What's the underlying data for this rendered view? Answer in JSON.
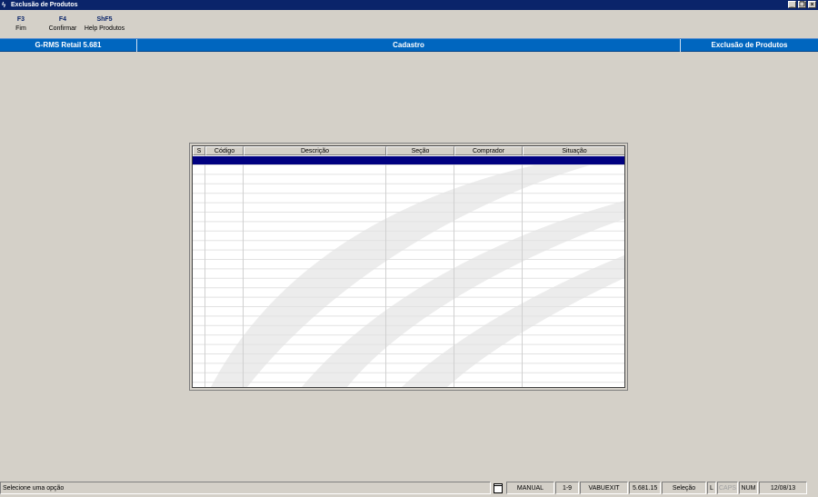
{
  "window": {
    "title": "Exclusão de Produtos",
    "buttons": {
      "minimize": "_",
      "restore": "❐",
      "close": "×"
    }
  },
  "fkeys": [
    {
      "key": "F3",
      "label": "Fim"
    },
    {
      "key": "F4",
      "label": "Confirmar"
    },
    {
      "key": "ShF5",
      "label": "Help Produtos"
    }
  ],
  "header": {
    "app": "G-RMS Retail 5.681",
    "module": "Cadastro",
    "screen": "Exclusão de Produtos"
  },
  "grid": {
    "columns": [
      "S",
      "Código",
      "Descrição",
      "Seção",
      "Comprador",
      "Situação"
    ],
    "selected_row_color": "#000080"
  },
  "status": {
    "message": "Selecione uma opção",
    "mode": "MANUAL",
    "range": "1-9",
    "program": "VABUEXIT",
    "version": "5.681.15",
    "action": "Seleção",
    "l": "L",
    "caps": "CAPS",
    "num": "NUM",
    "date": "12/08/13"
  },
  "colors": {
    "title_bar": "#0a246a",
    "header": "#0066bf",
    "background": "#d4d0c8"
  },
  "icons": {
    "app": "lightning-icon",
    "status_doc": "document-icon"
  }
}
